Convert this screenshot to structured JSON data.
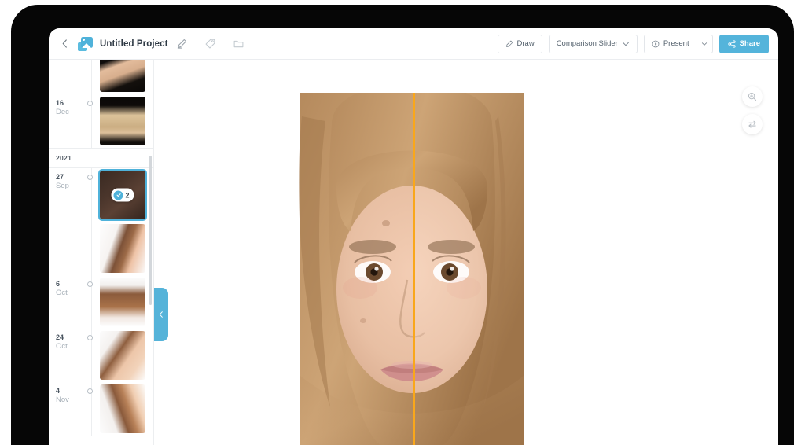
{
  "app": {
    "header": {
      "back_icon": "chevron-left-icon",
      "project_icon": "stacked-photos-icon",
      "title": "Untitled Project",
      "edit_icon": "pencil-icon",
      "tag_icon": "tag-icon",
      "folder_icon": "folder-icon",
      "toolbar": {
        "draw_label": "Draw",
        "draw_icon": "pen-icon",
        "comparison_label": "Comparison Slider",
        "comparison_caret_icon": "chevron-down-icon",
        "present_label": "Present",
        "present_icon": "play-circle-icon",
        "present_caret_icon": "chevron-down-icon",
        "share_label": "Share",
        "share_icon": "share-nodes-icon"
      }
    },
    "sidebar": {
      "collapse_icon": "chevron-left-icon",
      "groups": [
        {
          "type": "entry",
          "day": "",
          "month": "",
          "has_dot": false,
          "thumb_style": "dark-portrait-shoulders",
          "selected": false,
          "badge": null
        },
        {
          "type": "entry",
          "day": "16",
          "month": "Dec",
          "has_dot": true,
          "thumb_style": "dark-portrait-back",
          "selected": false,
          "badge": null
        },
        {
          "type": "year",
          "label": "2021"
        },
        {
          "type": "entry",
          "day": "27",
          "month": "Sep",
          "has_dot": true,
          "thumb_style": "dark-closeup",
          "selected": true,
          "badge": {
            "count": "2",
            "check_icon": "check-circle-icon"
          }
        },
        {
          "type": "entry",
          "day": "",
          "month": "",
          "has_dot": false,
          "thumb_style": "light-profile-left",
          "selected": false,
          "badge": null
        },
        {
          "type": "entry",
          "day": "6",
          "month": "Oct",
          "has_dot": true,
          "thumb_style": "light-back-ponytail",
          "selected": false,
          "badge": null
        },
        {
          "type": "entry",
          "day": "24",
          "month": "Oct",
          "has_dot": true,
          "thumb_style": "light-three-quarter",
          "selected": false,
          "badge": null
        },
        {
          "type": "entry",
          "day": "4",
          "month": "Nov",
          "has_dot": true,
          "thumb_style": "light-profile-right",
          "selected": false,
          "badge": null
        }
      ]
    },
    "canvas": {
      "tools": [
        {
          "name": "zoom-in-tool",
          "icon": "magnifier-plus-icon"
        },
        {
          "name": "flip-compare-tool",
          "icon": "swap-arrows-icon"
        }
      ],
      "comparison": {
        "mode": "Comparison Slider",
        "divider_color": "#f9a71b",
        "divider_position_pct": 50,
        "left_label": "",
        "right_label": ""
      }
    },
    "colors": {
      "accent": "#54b4db",
      "divider": "#f9a71b",
      "text": "#2f3a45",
      "muted": "#a7b0b8",
      "border": "#e3e6ea"
    }
  }
}
